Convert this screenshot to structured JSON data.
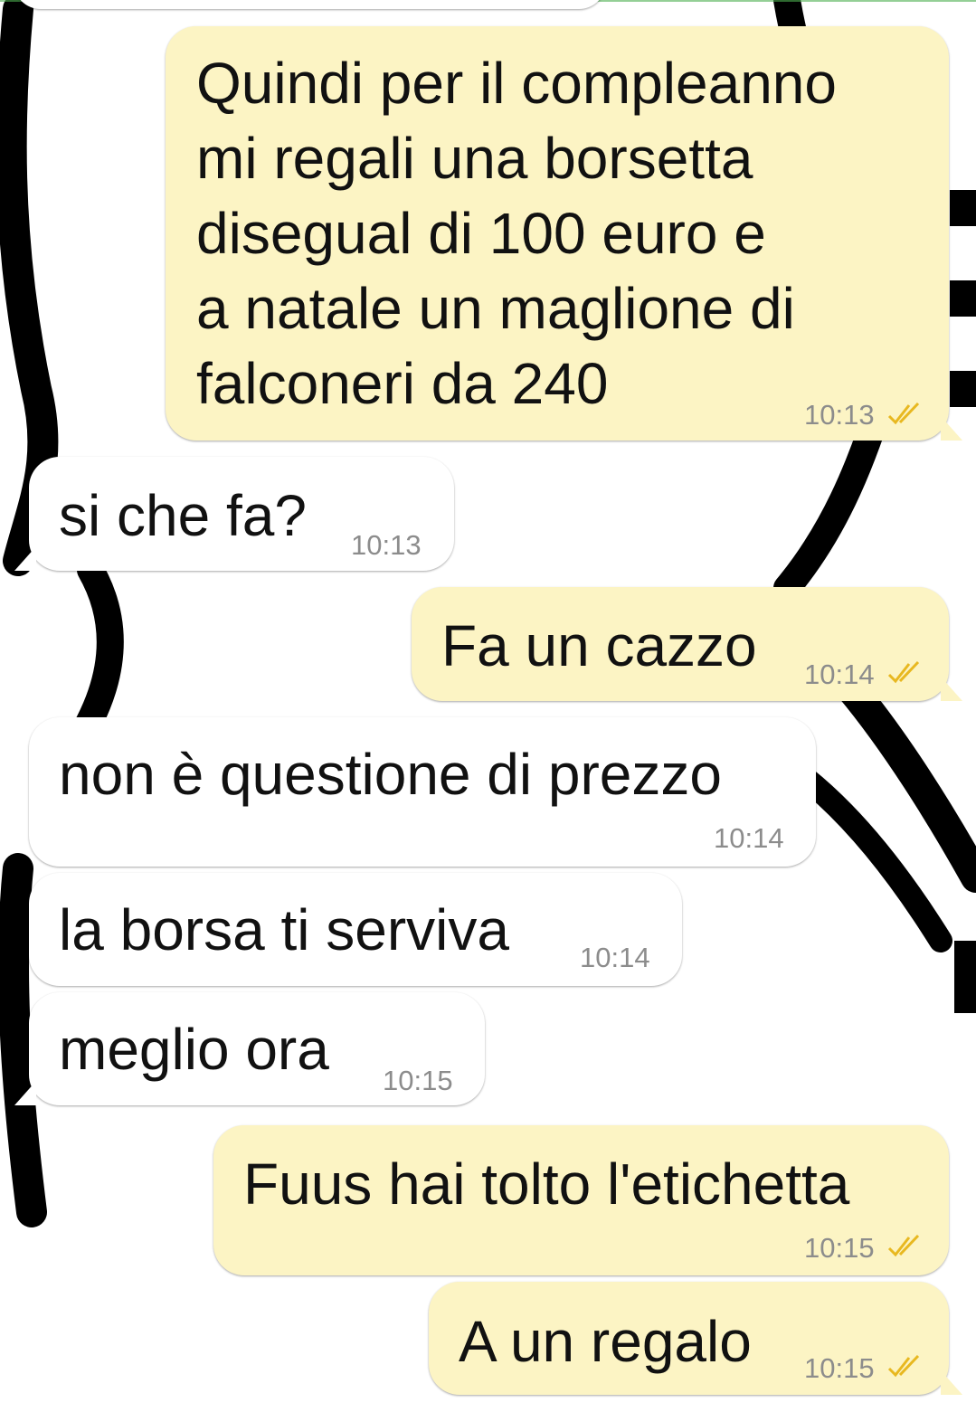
{
  "messages": [
    {
      "direction": "out",
      "text": "Quindi per il compleanno\nmi regali una borsetta\ndisegual di 100 euro e\na natale un maglione di\nfalconeri da 240",
      "time": "10:13",
      "status": "read"
    },
    {
      "direction": "in",
      "text": "si che fa?",
      "time": "10:13"
    },
    {
      "direction": "out",
      "text": "Fa un cazzo",
      "time": "10:14",
      "status": "read"
    },
    {
      "direction": "in",
      "text": "non è questione di prezzo",
      "time": "10:14"
    },
    {
      "direction": "in",
      "text": "la borsa ti serviva",
      "time": "10:14"
    },
    {
      "direction": "in",
      "text": "meglio ora",
      "time": "10:15"
    },
    {
      "direction": "out",
      "text": "Fuus hai tolto l'etichetta",
      "time": "10:15",
      "status": "read"
    },
    {
      "direction": "out",
      "text": "A un regalo",
      "time": "10:15",
      "status": "read"
    }
  ],
  "colors": {
    "outgoing_bubble": "#fcf4c4",
    "incoming_bubble": "#ffffff",
    "timestamp": "#8c8c8c",
    "read_ticks": "#e8b820"
  },
  "icons": {
    "read_receipt": "double-check-icon"
  }
}
